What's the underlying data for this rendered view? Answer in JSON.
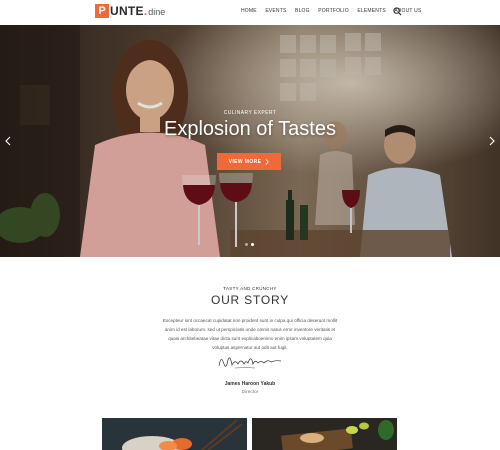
{
  "brand": {
    "logo_letter": "P",
    "logo_word": "UNTE",
    "logo_dot": ".",
    "logo_sub": "dine"
  },
  "nav": {
    "items": [
      "HOME",
      "EVENTS",
      "BLOG",
      "PORTFOLIO",
      "ELEMENTS",
      "ABOUT US"
    ]
  },
  "hero": {
    "kicker": "CULINARY EXPERT",
    "title": "Explosion of Tastes",
    "button_label": "VIEW MORE",
    "slides": 2,
    "active_slide": 1
  },
  "story": {
    "kicker": "TASTY AND CRUNCHY",
    "title": "OUR STORY",
    "text": "Excepteur sint occaecat cupidatat non proident sunt in culpa qui officia deserunt mollit anim id est laborum. sed ut perspiciatis unde omnis natus error inventore veritatis et quasi architebeatae vitae dicta sunt explicaboenimo enim ipsam voluptatem quia voluptas aspernatur aut odit aut fugit.",
    "signature": "Mayline",
    "author": "James Haroon Yakub",
    "role": "Director"
  },
  "colors": {
    "accent": "#ef6a3a",
    "text_dark": "#333333",
    "text_muted": "#777777"
  },
  "icons": {
    "search": "search-icon",
    "prev": "chevron-left-icon",
    "next": "chevron-right-icon",
    "button_arrow": "chevron-right-icon"
  }
}
